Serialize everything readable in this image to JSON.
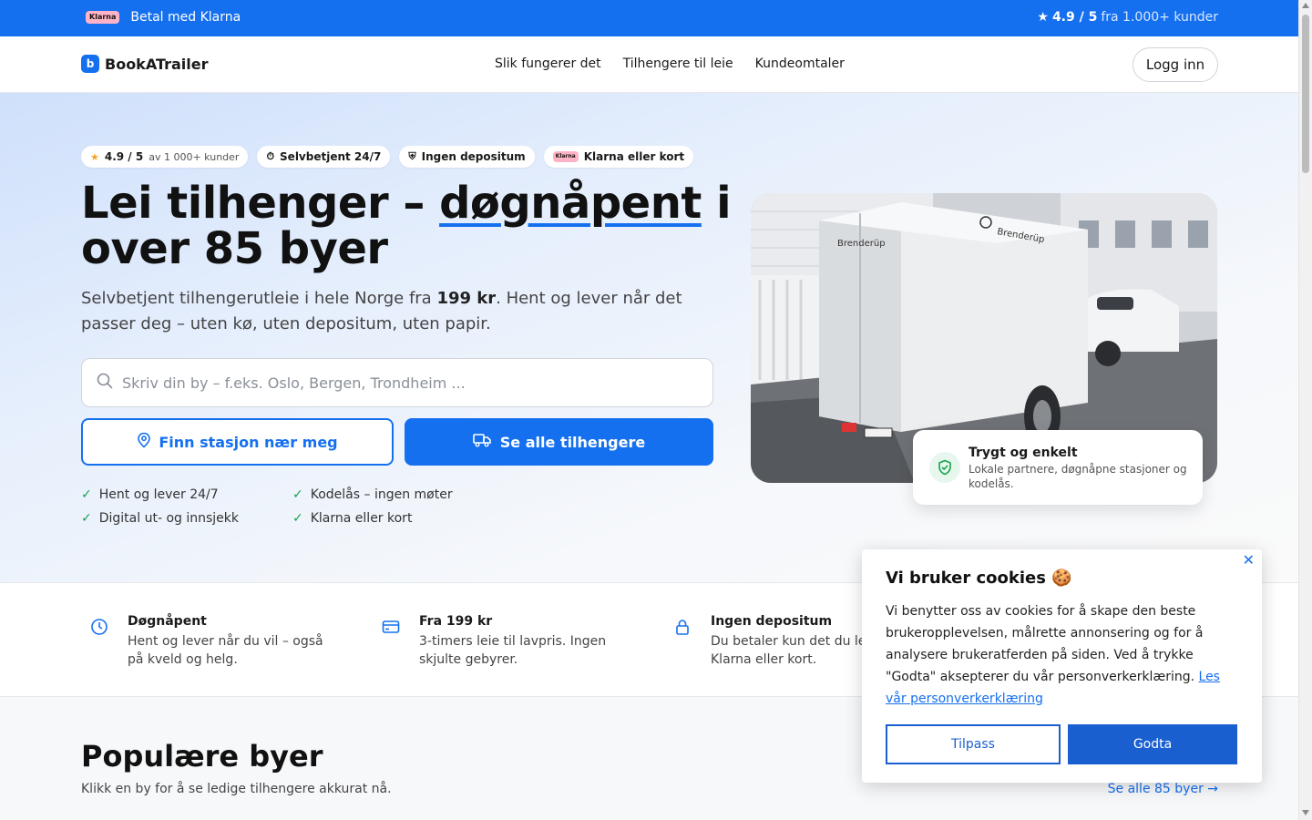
{
  "topbar": {
    "klarna_badge": "Klarna",
    "pay_text": "Betal med Klarna",
    "rating_icon": "star-icon",
    "rating_score": "4.9 / 5",
    "rating_from": "fra 1.000+ kunder"
  },
  "header": {
    "logo_mark": "b",
    "logo_text": "BookATrailer",
    "nav": [
      "Slik fungerer det",
      "Tilhengere til leie",
      "Kundeomtaler"
    ],
    "login": "Logg inn"
  },
  "hero": {
    "chips": {
      "rating": "4.9 / 5",
      "rating_sub": "av 1 000+ kunder",
      "self_service": "Selvbetjent 24/7",
      "no_deposit": "Ingen depositum",
      "klarna_badge": "Klarna",
      "payment": "Klarna eller kort"
    },
    "title_part1": "Lei tilhenger – ",
    "title_highlight": "døgnåpent",
    "title_part2": " i over 85 byer",
    "lead_part1": "Selvbetjent tilhengerutleie i hele Norge fra ",
    "lead_price": "199 kr",
    "lead_part2": ". Hent og lever når det passer deg – uten kø, uten depositum, uten papir.",
    "search_placeholder": "Skriv din by – f.eks. Oslo, Bergen, Trondheim ...",
    "btn_find": "Finn stasjon nær meg",
    "btn_all": "Se alle tilhengere",
    "checks": [
      "Hent og lever 24/7",
      "Kodelås – ingen møter",
      "Digital ut- og innsjekk",
      "Klarna eller kort"
    ],
    "photo_brand": "Brenderüp",
    "trust_title": "Trygt og enkelt",
    "trust_text": "Lokale partnere, døgnåpne stasjoner og kodelås."
  },
  "features": [
    {
      "icon": "clock-icon",
      "title": "Døgnåpent",
      "text": "Hent og lever når du vil – også på kveld og helg."
    },
    {
      "icon": "card-icon",
      "title": "Fra 199 kr",
      "text": "3-timers leie til lavpris. Ingen skjulte gebyrer."
    },
    {
      "icon": "lock-icon",
      "title": "Ingen depositum",
      "text": "Du betaler kun det du leier med Klarna eller kort."
    }
  ],
  "popular": {
    "title": "Populære byer",
    "subtitle": "Klikk en by for å se ledige tilhengere akkurat nå.",
    "see_all": "Se alle 85 byer →"
  },
  "cookie": {
    "title": "Vi bruker cookies 🍪",
    "text": "Vi benytter oss av cookies for å skape den beste brukeropplevelsen, målrette annonsering og for å analysere brukeratferden på siden. Ved å trykke \"Godta\" aksepterer du vår personverkerklæring.",
    "link": "Les vår personverkerklæring",
    "customize": "Tilpass",
    "accept": "Godta",
    "close": "✕"
  },
  "colors": {
    "brand": "#1570ef",
    "success": "#16a34a",
    "klarna": "#ffb3c7"
  }
}
